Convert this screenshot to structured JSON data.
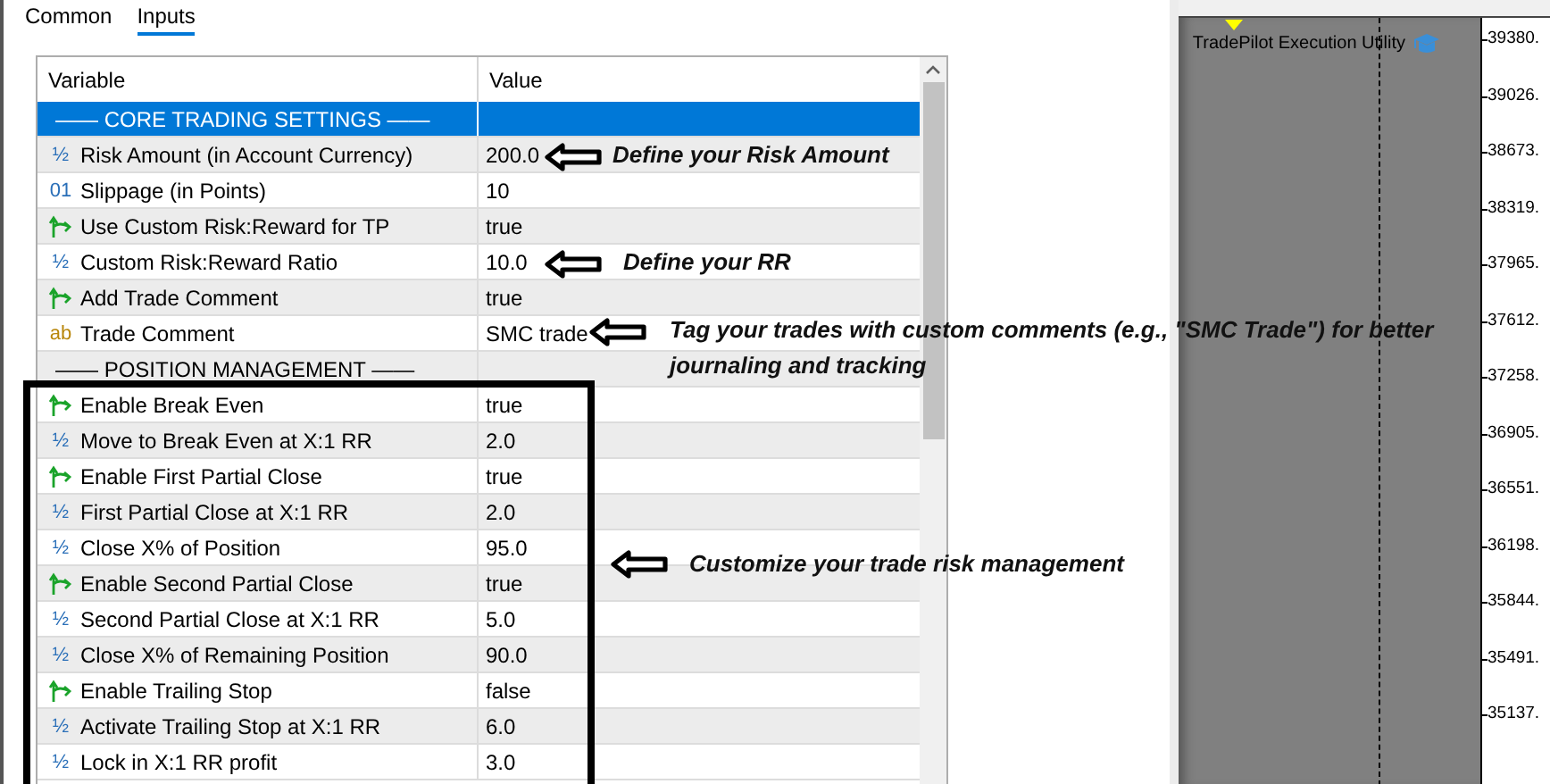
{
  "tabs": [
    {
      "label": "Common",
      "selected": false
    },
    {
      "label": "Inputs",
      "selected": true
    }
  ],
  "table": {
    "columns": [
      "Variable",
      "Value"
    ],
    "rows": [
      {
        "kind": "group",
        "variable": "—— CORE TRADING SETTINGS ——",
        "selected": true
      },
      {
        "kind": "double",
        "icon": "½",
        "variable": "Risk Amount (in Account Currency)",
        "value": "200.0",
        "selected": false
      },
      {
        "kind": "int",
        "icon": "01",
        "variable": "Slippage (in Points)",
        "value": "10",
        "selected": false
      },
      {
        "kind": "bool",
        "variable": "Use Custom Risk:Reward for TP",
        "value": "true",
        "selected": false
      },
      {
        "kind": "double",
        "icon": "½",
        "variable": "Custom Risk:Reward Ratio",
        "value": "10.0",
        "selected": false
      },
      {
        "kind": "bool",
        "variable": "Add Trade Comment",
        "value": "true",
        "selected": false
      },
      {
        "kind": "string",
        "icon": "ab",
        "variable": "Trade Comment",
        "value": "SMC trade",
        "selected": false
      },
      {
        "kind": "group",
        "variable": "—— POSITION MANAGEMENT ——",
        "selected": false
      },
      {
        "kind": "bool",
        "variable": "Enable Break Even",
        "value": "true",
        "selected": false
      },
      {
        "kind": "double",
        "icon": "½",
        "variable": "Move to Break Even at X:1 RR",
        "value": "2.0",
        "selected": false
      },
      {
        "kind": "bool",
        "variable": "Enable First Partial Close",
        "value": "true",
        "selected": false
      },
      {
        "kind": "double",
        "icon": "½",
        "variable": "First Partial Close at X:1 RR",
        "value": "2.0",
        "selected": false
      },
      {
        "kind": "double",
        "icon": "½",
        "variable": "Close X% of Position",
        "value": "95.0",
        "selected": false
      },
      {
        "kind": "bool",
        "variable": "Enable Second Partial Close",
        "value": "true",
        "selected": false
      },
      {
        "kind": "double",
        "icon": "½",
        "variable": "Second Partial Close at X:1 RR",
        "value": "5.0",
        "selected": false
      },
      {
        "kind": "double",
        "icon": "½",
        "variable": "Close X% of Remaining Position",
        "value": "90.0",
        "selected": false
      },
      {
        "kind": "bool",
        "variable": "Enable Trailing Stop",
        "value": "false",
        "selected": false
      },
      {
        "kind": "double",
        "icon": "½",
        "variable": "Activate Trailing Stop at X:1 RR",
        "value": "6.0",
        "selected": false
      },
      {
        "kind": "double",
        "icon": "½",
        "variable": "Lock in X:1 RR profit",
        "value": "3.0",
        "selected": false
      }
    ]
  },
  "annotations": [
    "Define your Risk Amount",
    "Define your RR",
    "Tag your trades with custom comments (e.g., \"SMC Trade\") for better journaling and tracking",
    "Customize your trade risk management"
  ],
  "chart": {
    "title": "TradePilot Execution Utility",
    "price_labels": [
      "39380.",
      "39026.",
      "38673.",
      "38319.",
      "37965.",
      "37612.",
      "37258.",
      "36905.",
      "36551.",
      "36198.",
      "35844.",
      "35491.",
      "35137."
    ]
  }
}
